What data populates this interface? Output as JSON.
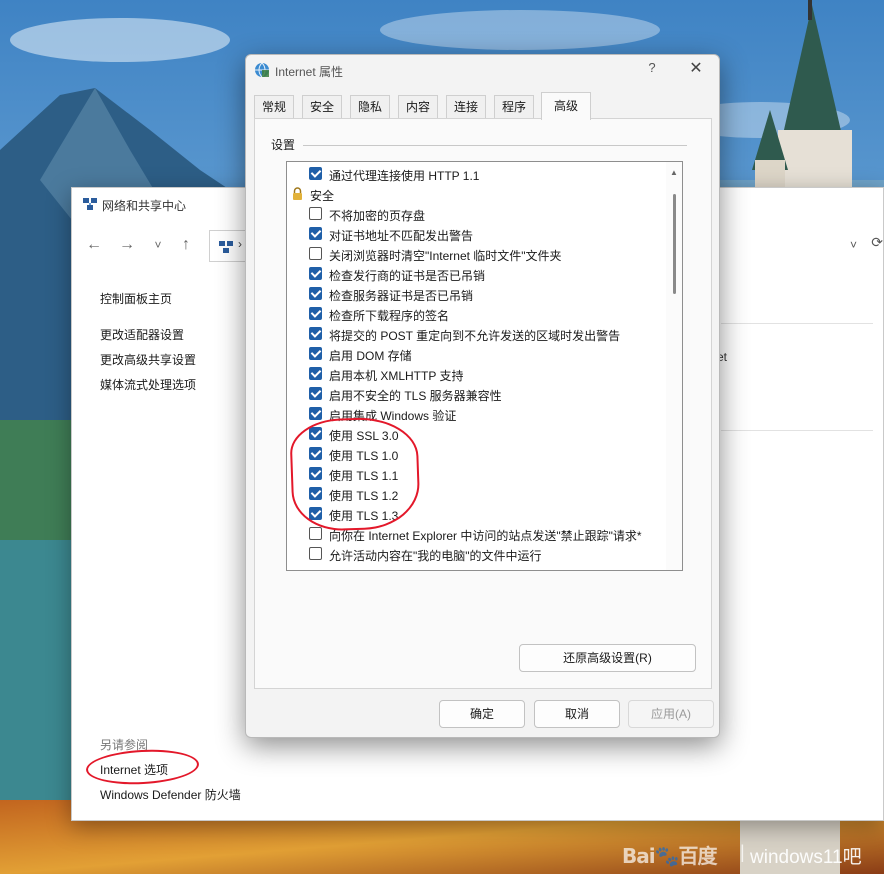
{
  "background_window": {
    "title": "网络和共享中心",
    "nav": {
      "back": "←",
      "forward": "→",
      "recent": "˅",
      "up": "↑",
      "chevron": "›",
      "dropdown": "˅",
      "search": "⟳"
    },
    "sidebar_links": [
      "控制面板主页",
      "更改适配器设置",
      "更改高级共享设置",
      "媒体流式处理选项"
    ],
    "right_fragment": "et",
    "see_also_label": "另请参阅",
    "internet_options_link": "Internet 选项",
    "firewall_link": "Windows Defender 防火墙"
  },
  "dialog": {
    "title": "Internet 属性",
    "help_label": "?",
    "close_label": "✕",
    "tabs": [
      {
        "label": "常规",
        "active": false
      },
      {
        "label": "安全",
        "active": false
      },
      {
        "label": "隐私",
        "active": false
      },
      {
        "label": "内容",
        "active": false
      },
      {
        "label": "连接",
        "active": false
      },
      {
        "label": "程序",
        "active": false
      },
      {
        "label": "高级",
        "active": true
      }
    ],
    "group_label": "设置",
    "settings": [
      {
        "label": "通过代理连接使用 HTTP 1.1",
        "checked": true
      },
      {
        "label": "安全",
        "section": true
      },
      {
        "label": "不将加密的页存盘",
        "checked": false
      },
      {
        "label": "对证书地址不匹配发出警告",
        "checked": true
      },
      {
        "label": "关闭浏览器时清空\"Internet 临时文件\"文件夹",
        "checked": false
      },
      {
        "label": "检查发行商的证书是否已吊销",
        "checked": true
      },
      {
        "label": "检查服务器证书是否已吊销",
        "checked": true
      },
      {
        "label": "检查所下载程序的签名",
        "checked": true
      },
      {
        "label": "将提交的 POST 重定向到不允许发送的区域时发出警告",
        "checked": true
      },
      {
        "label": "启用 DOM 存储",
        "checked": true
      },
      {
        "label": "启用本机 XMLHTTP 支持",
        "checked": true
      },
      {
        "label": "启用不安全的 TLS 服务器兼容性",
        "checked": true
      },
      {
        "label": "启用集成 Windows 验证",
        "checked": true
      },
      {
        "label": "使用 SSL 3.0",
        "checked": true
      },
      {
        "label": "使用 TLS 1.0",
        "checked": true
      },
      {
        "label": "使用 TLS 1.1",
        "checked": true
      },
      {
        "label": "使用 TLS 1.2",
        "checked": true
      },
      {
        "label": "使用 TLS 1.3",
        "checked": true
      },
      {
        "label": "向你在 Internet Explorer 中访问的站点发送\"禁止跟踪\"请求*",
        "checked": false
      },
      {
        "label": "允许活动内容在\"我的电脑\"的文件中运行",
        "checked": false
      }
    ],
    "restore_button": "还原高级设置(R)",
    "ok_button": "确定",
    "cancel_button": "取消",
    "apply_button": "应用(A)"
  },
  "watermark": {
    "brand": "Bai🐾百度",
    "separator": "|",
    "site": "windows11吧"
  },
  "colors": {
    "checkbox_on": "#1f5fa8",
    "annotation_red": "#e3182a"
  }
}
